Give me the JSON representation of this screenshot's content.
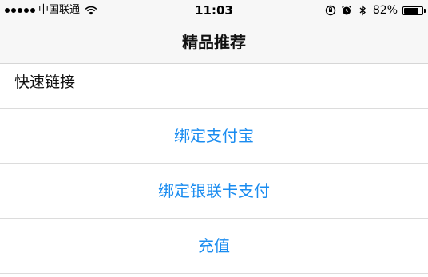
{
  "status_bar": {
    "carrier": "中国联通",
    "time": "11:03",
    "battery_percent": "82%",
    "battery_level": 0.82
  },
  "nav": {
    "title": "精品推荐"
  },
  "section": {
    "title": "快速链接"
  },
  "actions": [
    {
      "label": "绑定支付宝"
    },
    {
      "label": "绑定银联卡支付"
    },
    {
      "label": "充值"
    }
  ],
  "colors": {
    "link": "#1a8cf0",
    "bar_background": "#f7f7f7",
    "divider": "#dcdcdc"
  }
}
